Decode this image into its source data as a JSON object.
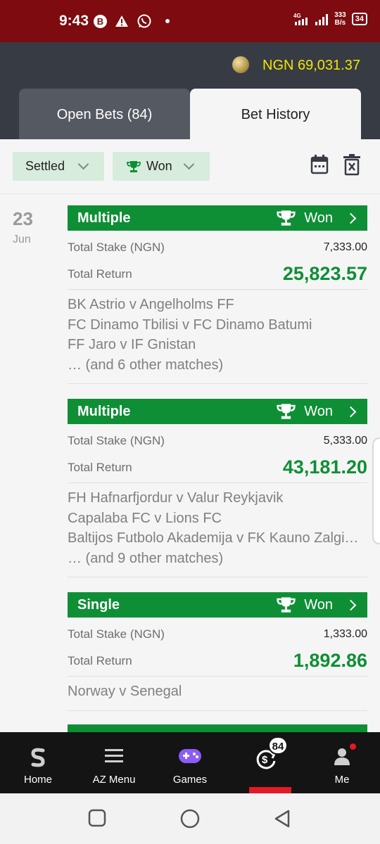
{
  "status_bar": {
    "time": "9:43",
    "b_badge": "B",
    "network": "4G",
    "net_speed_line1": "333",
    "net_speed_line2": "B/s",
    "battery": "34"
  },
  "header": {
    "balance": "NGN 69,031.37",
    "tabs": [
      {
        "label": "Open Bets (84)",
        "active": false
      },
      {
        "label": "Bet History",
        "active": true
      }
    ]
  },
  "filters": {
    "status_label": "Settled",
    "result_label": "Won"
  },
  "date": {
    "day": "23",
    "month": "Jun"
  },
  "bets": [
    {
      "type": "Multiple",
      "status": "Won",
      "stake_label": "Total Stake (NGN)",
      "stake": "7,333.00",
      "return_label": "Total Return",
      "return": "25,823.57",
      "matches": [
        "BK Astrio v Angelholms FF",
        "FC Dinamo Tbilisi v FC Dinamo Batumi",
        "FF Jaro v IF Gnistan",
        "… (and 6 other matches)"
      ]
    },
    {
      "type": "Multiple",
      "status": "Won",
      "stake_label": "Total Stake (NGN)",
      "stake": "5,333.00",
      "return_label": "Total Return",
      "return": "43,181.20",
      "matches": [
        "FH Hafnarfjordur v Valur Reykjavik",
        "Capalaba FC v Lions FC",
        "Baltijos Futbolo Akademija v FK Kauno Zalgi…",
        "… (and 9 other matches)"
      ]
    },
    {
      "type": "Single",
      "status": "Won",
      "stake_label": "Total Stake (NGN)",
      "stake": "1,333.00",
      "return_label": "Total Return",
      "return": "1,892.86",
      "matches": [
        "Norway v Senegal"
      ]
    }
  ],
  "bottom_nav": {
    "items": [
      {
        "label": "Home",
        "icon": "sporty-logo-icon"
      },
      {
        "label": "AZ Menu",
        "icon": "hamburger-menu-icon"
      },
      {
        "label": "Games",
        "icon": "gamepad-icon"
      },
      {
        "label": "",
        "icon": "cashout-icon",
        "badge": "84",
        "active": true
      },
      {
        "label": "Me",
        "icon": "user-icon"
      }
    ]
  },
  "colors": {
    "status_bar": "#7d0b0f",
    "header": "#373b44",
    "won_green": "#0e8f35",
    "balance_yellow": "#f1e600",
    "active_red": "#e41827"
  }
}
